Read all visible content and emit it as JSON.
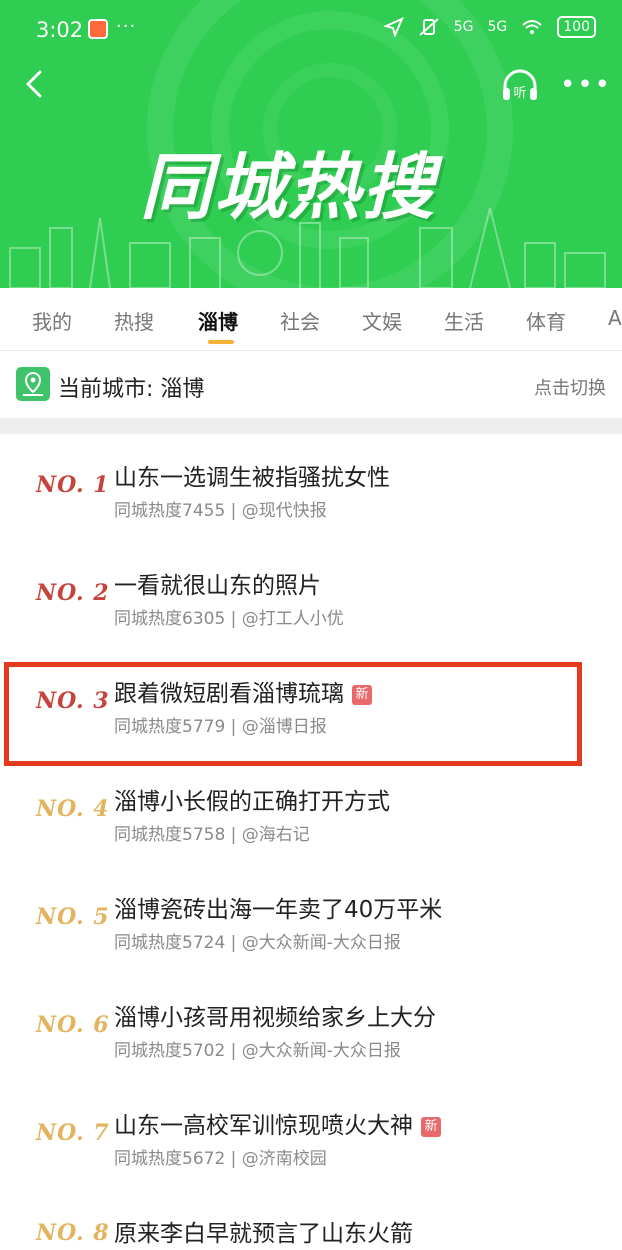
{
  "status": {
    "time": "3:02",
    "dots": "···",
    "signal1": "5G",
    "signal2": "5G",
    "battery": "100"
  },
  "header": {
    "title": "同城热搜",
    "listen_label": "听"
  },
  "tabs": [
    {
      "label": "我的"
    },
    {
      "label": "热搜"
    },
    {
      "label": "淄博",
      "active": true
    },
    {
      "label": "社会"
    },
    {
      "label": "文娱"
    },
    {
      "label": "生活"
    },
    {
      "label": "体育"
    },
    {
      "label": "A"
    }
  ],
  "city": {
    "label": "当前城市: 淄博",
    "switch_label": "点击切换"
  },
  "items": [
    {
      "rank": "NO. 1",
      "title": "山东一选调生被指骚扰女性",
      "meta": "同城热度7455 | @现代快报",
      "is_new": false,
      "rank_color": "red"
    },
    {
      "rank": "NO. 2",
      "title": "一看就很山东的照片",
      "meta": "同城热度6305 | @打工人小优",
      "is_new": false,
      "rank_color": "red"
    },
    {
      "rank": "NO. 3",
      "title": "跟着微短剧看淄博琉璃",
      "meta": "同城热度5779 | @淄博日报",
      "is_new": true,
      "new_label": "新",
      "rank_color": "red"
    },
    {
      "rank": "NO. 4",
      "title": "淄博小长假的正确打开方式",
      "meta": "同城热度5758 | @海右记",
      "is_new": false,
      "rank_color": "gold"
    },
    {
      "rank": "NO. 5",
      "title": "淄博瓷砖出海一年卖了40万平米",
      "meta": "同城热度5724 | @大众新闻-大众日报",
      "is_new": false,
      "rank_color": "gold"
    },
    {
      "rank": "NO. 6",
      "title": "淄博小孩哥用视频给家乡上大分",
      "meta": "同城热度5702 | @大众新闻-大众日报",
      "is_new": false,
      "rank_color": "gold"
    },
    {
      "rank": "NO. 7",
      "title": "山东一高校军训惊现喷火大神",
      "meta": "同城热度5672 | @济南校园",
      "is_new": true,
      "new_label": "新",
      "rank_color": "gold"
    },
    {
      "rank": "NO. 8",
      "title": "原来李白早就预言了山东火箭",
      "meta": "",
      "is_new": false,
      "rank_color": "gold"
    }
  ],
  "colors": {
    "header_green": "#2fce52",
    "highlight_red": "#e53a1d",
    "rank_red": "#c6443c",
    "rank_gold": "#e4b35e",
    "tab_indicator": "#f5b23a"
  }
}
